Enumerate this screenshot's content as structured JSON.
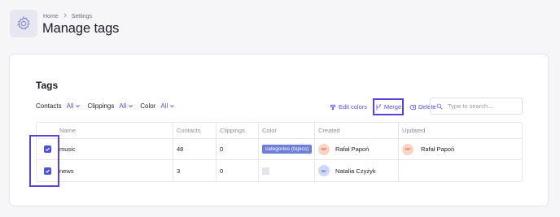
{
  "breadcrumb": {
    "home": "Home",
    "current": "Settings",
    "separator": ">"
  },
  "page_title": "Manage tags",
  "card": {
    "title": "Tags"
  },
  "filters": [
    {
      "label": "Contacts",
      "value": "All"
    },
    {
      "label": "Clippings",
      "value": "All"
    },
    {
      "label": "Color",
      "value": "All"
    }
  ],
  "actions": {
    "edit_colors": "Edit colors",
    "merge": "Merge",
    "delete": "Delete"
  },
  "search": {
    "placeholder": "Type to search..."
  },
  "table": {
    "columns": {
      "name": "Name",
      "contacts": "Contacts",
      "clippings": "Clippings",
      "color": "Color",
      "created": "Created",
      "updated": "Updated"
    },
    "rows": [
      {
        "checked": true,
        "name": "music",
        "contacts": "48",
        "clippings": "0",
        "color": "categories (topics)",
        "created_initials": "RP",
        "created_by": "Rafał Papoń",
        "updated_initials": "RP",
        "updated_by": "Rafał Papoń"
      },
      {
        "checked": true,
        "name": "news",
        "contacts": "3",
        "clippings": "0",
        "color": "",
        "created_initials": "NC",
        "created_by": "Natalia Czyżyk",
        "updated_initials": "",
        "updated_by": ""
      }
    ]
  },
  "colors": {
    "accent": "#4f52d6",
    "highlight": "#5a44d8",
    "tag_pill": "#6f7fd8"
  },
  "icons": {
    "header": "gear-icon",
    "edit_colors": "paint-bucket-icon",
    "merge": "merge-icon",
    "delete": "backspace-icon",
    "search": "search-icon",
    "filter_dropdown": "chevron-down-icon",
    "checkbox": "check-icon"
  }
}
